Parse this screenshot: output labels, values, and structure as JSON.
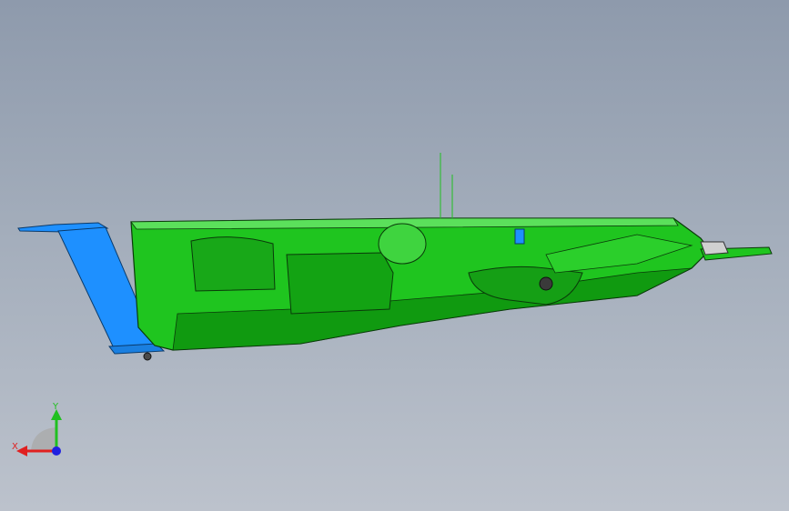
{
  "viewport": {
    "background_top": "#8e9aac",
    "background_bottom": "#bcc2cc"
  },
  "model": {
    "body_color": "#1fc51f",
    "body_shadow_color": "#109a10",
    "body_highlight_color": "#5be05b",
    "bracket_color": "#1e90ff",
    "edge_color": "#0a3a0a"
  },
  "triad": {
    "x_label": "X",
    "y_label": "Y",
    "x_color": "#e02020",
    "y_color": "#20c020",
    "z_color": "#2020e0"
  }
}
